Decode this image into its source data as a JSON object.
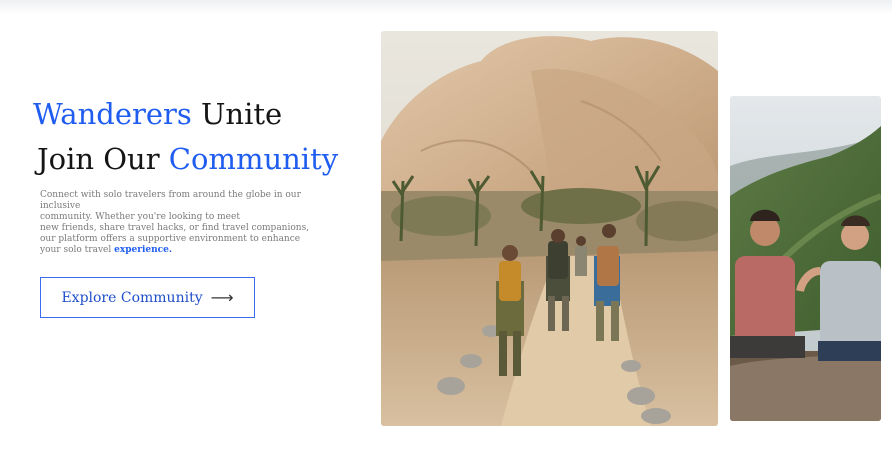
{
  "hero": {
    "title_line1_accent": "Wanderers",
    "title_line1_rest": "Unite",
    "title_line2_plain": "Join Our",
    "title_line2_accent": "Community",
    "description_l1": "Connect with solo travelers from around the globe in our inclusive",
    "description_l2": "community. Whether you're looking to meet",
    "description_l3": "new friends, share travel hacks, or find travel companions,",
    "description_l4": "our platform offers a supportive environment to enhance",
    "description_l5": "your solo travel",
    "description_highlight": "experience.",
    "cta_label": "Explore Community",
    "cta_arrow": "⟶"
  },
  "colors": {
    "accent": "#1f5cf0",
    "text": "#151515",
    "muted": "#7a7a7a"
  },
  "images": {
    "main_photo": "hikers-desert-trail-photo",
    "side_photo": "friends-on-mountain-photo"
  }
}
